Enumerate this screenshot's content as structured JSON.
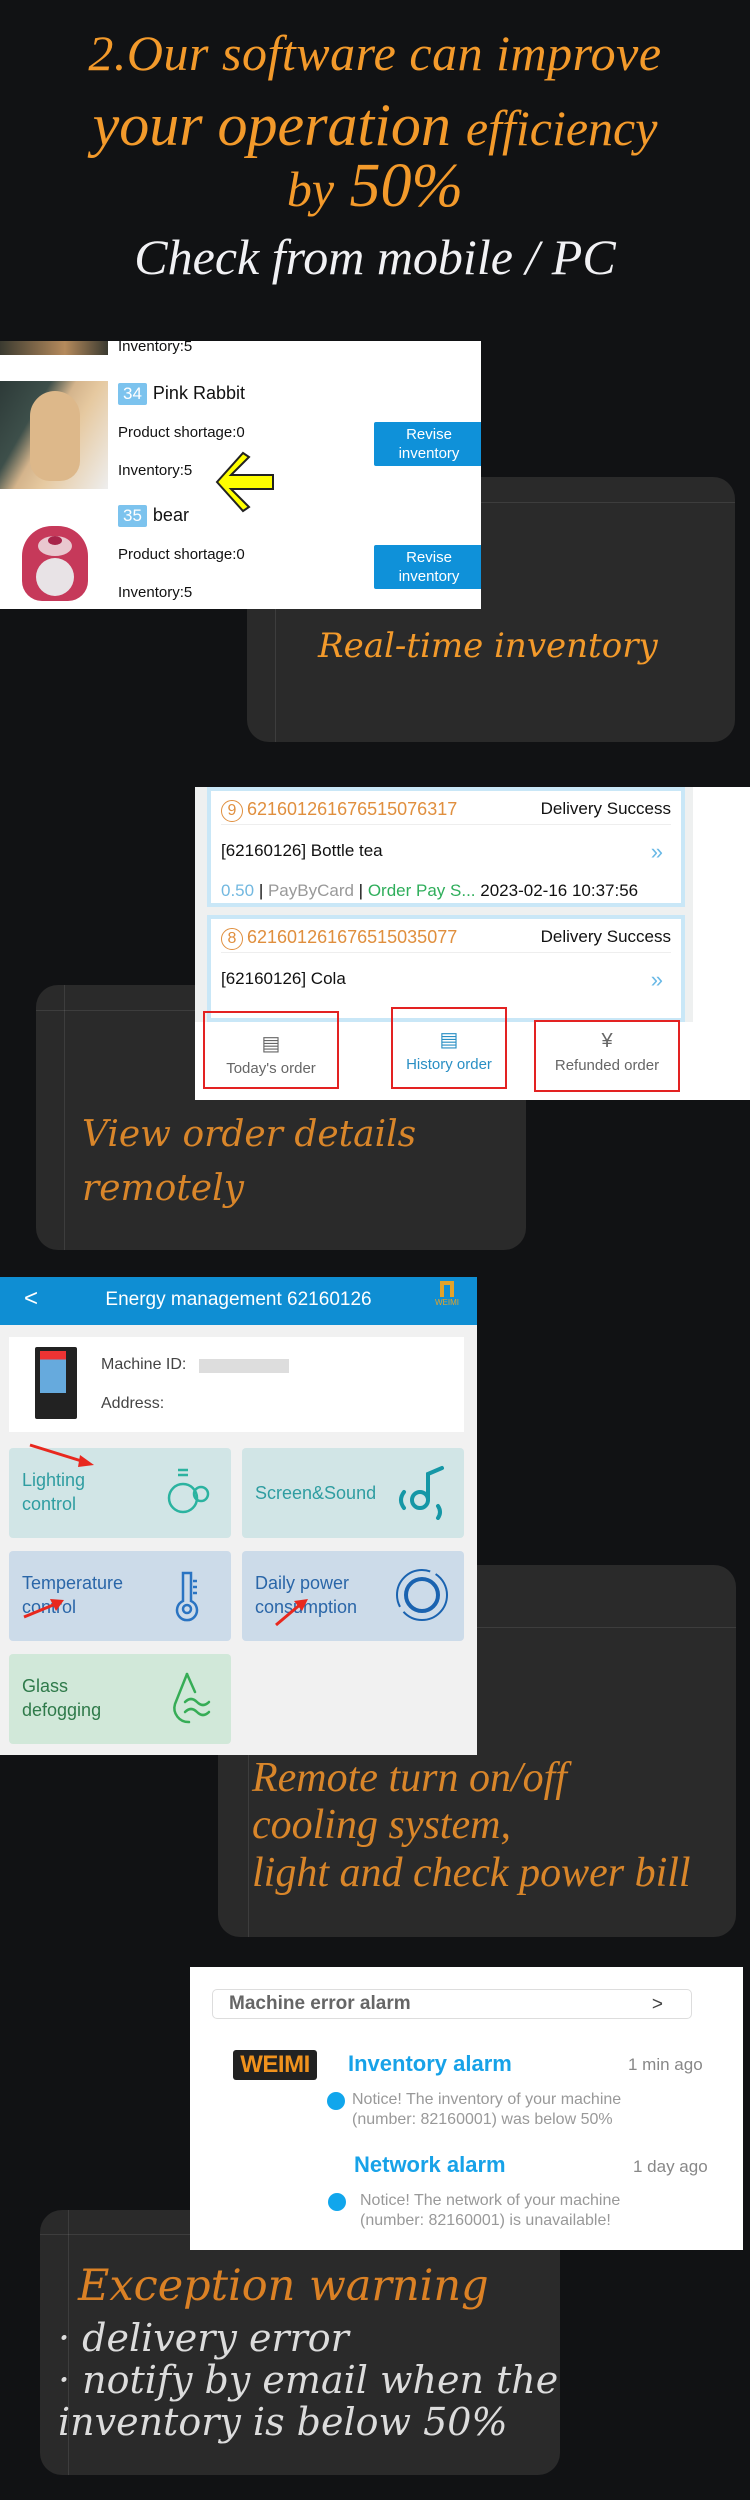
{
  "headline": {
    "line1": "2.Our software can improve",
    "line2_big": "your operation",
    "line2_small": "efficiency",
    "line3_small": "by",
    "line3_big": "50%",
    "subtitle": "Check from mobile / PC"
  },
  "inventory": {
    "partial_top_inventory": "Inventory:5",
    "items": [
      {
        "number": "34",
        "name": "Pink Rabbit",
        "shortage": "Product shortage:0",
        "inventory": "Inventory:5",
        "button": "Revise inventory"
      },
      {
        "number": "35",
        "name": "bear",
        "shortage": "Product shortage:0",
        "inventory": "Inventory:5",
        "button": "Revise inventory"
      }
    ],
    "caption": "Real-time inventory"
  },
  "orders": {
    "cards": [
      {
        "index": "9",
        "order_id": "621601261676515076317",
        "status": "Delivery Success",
        "title": "[62160126] Bottle tea",
        "amount": "0.50",
        "payment": "PayByCard",
        "pay_status": "Order Pay S...",
        "datetime": "2023-02-16 10:37:56"
      },
      {
        "index": "8",
        "order_id": "621601261676515035077",
        "status": "Delivery Success",
        "title": "[62160126] Cola"
      }
    ],
    "tabs": [
      "Today's order",
      "History order",
      "Refunded order"
    ],
    "caption_line1": "View order details",
    "caption_line2": "remotely"
  },
  "energy": {
    "title": "Energy management 62160126",
    "back": "<",
    "logo": "WEIMI",
    "machine_id_label": "Machine ID:",
    "address_label": "Address:",
    "tiles": [
      {
        "line1": "Lighting",
        "line2": "control"
      },
      {
        "line1": "Screen&Sound",
        "line2": ""
      },
      {
        "line1": "Temperature",
        "line2": "control"
      },
      {
        "line1": "Daily power",
        "line2": "consumption"
      },
      {
        "line1": "Glass",
        "line2": "defogging"
      }
    ],
    "caption_lines": [
      "Remote turn on/off",
      "cooling system,",
      "light and check power bill"
    ]
  },
  "alarm": {
    "header": "Machine error alarm",
    "header_arrow": ">",
    "logo": "WEIMI",
    "items": [
      {
        "title": "Inventory alarm",
        "time": "1 min ago",
        "msg1": "Notice! The inventory of your machine",
        "msg2": "(number: 82160001) was below 50%"
      },
      {
        "title": "Network alarm",
        "time": "1 day ago",
        "msg1": "Notice! The network of your machine",
        "msg2": "(number: 82160001) is unavailable!"
      }
    ],
    "caption": "Exception warning",
    "bullets": [
      "· delivery error",
      "· notify by email when the",
      "inventory is below 50%"
    ]
  }
}
